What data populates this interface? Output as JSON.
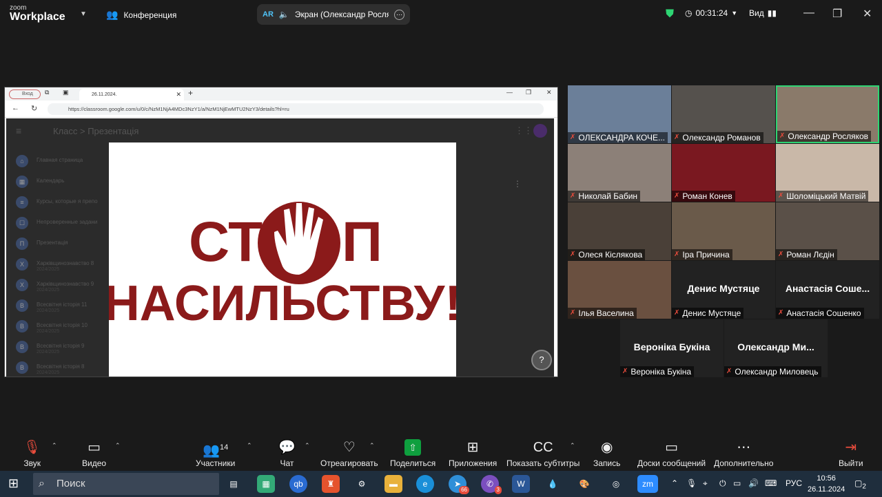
{
  "zoom": {
    "logo_small": "zoom",
    "logo_big": "Workplace",
    "conference": "Конференция",
    "share_label": "Экран (Олександр Росляко",
    "ar": "AR",
    "timer": "00:31:24",
    "view": "Вид"
  },
  "browser": {
    "account": "Вход",
    "tab_title": "26.11.2024.",
    "url": "https://classroom.google.com/u/0/c/NzM1NjA4MDc3NzY1/a/NzM1NjEwMTU2NzY3/details?hl=ru"
  },
  "classroom": {
    "crumb": "Класс  >  Презентація",
    "sidebar": [
      {
        "icon": "⌂",
        "label": "Главная страница",
        "sub": ""
      },
      {
        "icon": "▦",
        "label": "Календарь",
        "sub": ""
      },
      {
        "icon": "≡",
        "label": "Курсы, которые я препо",
        "sub": ""
      },
      {
        "icon": "☐",
        "label": "Непроверенные задани",
        "sub": ""
      },
      {
        "icon": "П",
        "label": "Презентація",
        "sub": ""
      },
      {
        "icon": "Х",
        "label": "Харківщинознавство 8",
        "sub": "2024/2025"
      },
      {
        "icon": "Х",
        "label": "Харківщинознавство 9",
        "sub": "2024/2025"
      },
      {
        "icon": "В",
        "label": "Всесвітня історія 11",
        "sub": "2024/2025"
      },
      {
        "icon": "В",
        "label": "Всесвітня історія 10",
        "sub": "2024/2025"
      },
      {
        "icon": "В",
        "label": "Всесвітня історія 9",
        "sub": "2024/2025"
      },
      {
        "icon": "В",
        "label": "Всесвітня історія 8",
        "sub": "2024/2025"
      }
    ]
  },
  "slide": {
    "line1a": "СТ",
    "line1b": "П",
    "line2": "НАСИЛЬСТВУ!"
  },
  "participants": [
    {
      "name": "ОЛЕКСАНДРА КОЧЕ...",
      "big": ""
    },
    {
      "name": "Олександр Романов",
      "big": ""
    },
    {
      "name": "Олександр Росляков",
      "big": ""
    },
    {
      "name": "Николай Бабин",
      "big": ""
    },
    {
      "name": "Роман Конев",
      "big": ""
    },
    {
      "name": "Шоломіцький Матвій",
      "big": ""
    },
    {
      "name": "Олеся Кіслякова",
      "big": ""
    },
    {
      "name": "Іра Причина",
      "big": ""
    },
    {
      "name": "Роман Лєдін",
      "big": ""
    },
    {
      "name": "Ілья Васелина",
      "big": ""
    },
    {
      "name": "Денис Мустяце",
      "big": "Денис Мустяце"
    },
    {
      "name": "Анастасія Сошенко",
      "big": "Анастасія Соше..."
    },
    {
      "name": "Вероніка Букіна",
      "big": "Вероніка Букіна"
    },
    {
      "name": "Олександр Миловець",
      "big": "Олександр Ми..."
    }
  ],
  "toolbar": {
    "sound": "Звук",
    "video": "Видео",
    "participants": "Участники",
    "participants_count": "14",
    "chat": "Чат",
    "react": "Отреагировать",
    "share": "Поделиться",
    "apps": "Приложения",
    "captions": "Показать субтитры",
    "record": "Запись",
    "boards": "Доски сообщений",
    "more": "Дополнительно",
    "leave": "Выйти"
  },
  "taskbar": {
    "search": "Поиск",
    "lang": "РУС",
    "time": "10:56",
    "date": "26.11.2024",
    "notif": "2",
    "badge1": "66",
    "badge2": "3"
  },
  "colors": {
    "slide_red": "#8b1a1a",
    "zoom_green": "#0e9f3e"
  }
}
